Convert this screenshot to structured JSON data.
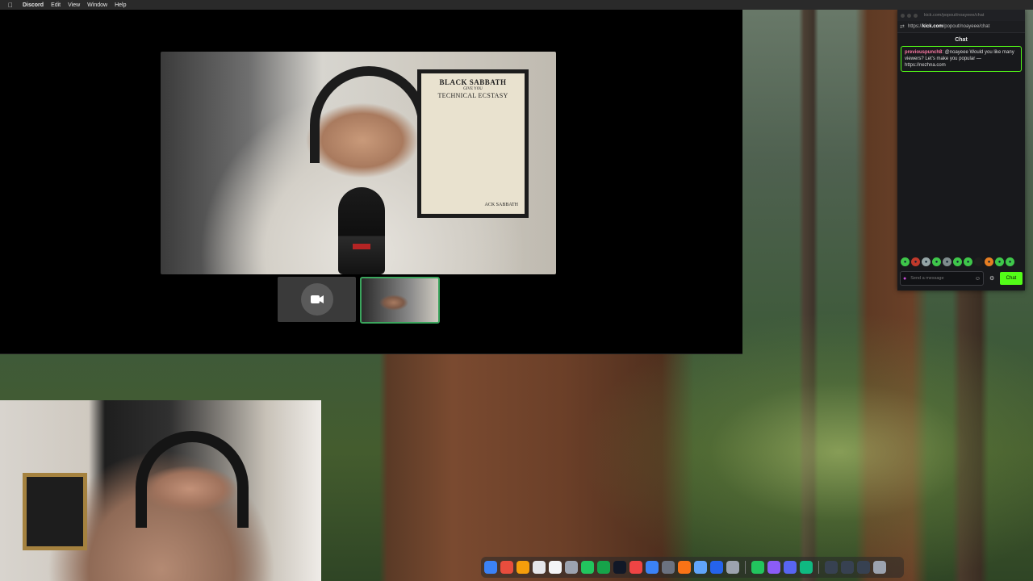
{
  "menubar": {
    "app_name": "Discord",
    "items": [
      "Edit",
      "View",
      "Window",
      "Help"
    ]
  },
  "discord": {
    "main_video_poster": {
      "line1": "BLACK SABBATH",
      "line2": "GIVE YOU",
      "line3": "TECHNICAL ECSTASY",
      "line4": "ACK SABBATH"
    }
  },
  "kick_chat": {
    "url_plain_1": "https://",
    "url_bold": "kick.com",
    "url_plain_2": "/popout/noayeee/chat",
    "titlebar_url": "kick.com/popout/noayeee/chat",
    "heading": "Chat",
    "message": {
      "username": "previouspunch8",
      "text": ": @noayeee Would you like many viewers? Let's make you popular — https://nezhna.com"
    },
    "input_placeholder": "Send a message",
    "send_label": "Chat",
    "colors": {
      "accent": "#53fc18",
      "username": "#ff7aa6"
    }
  },
  "dock": {
    "apps": [
      {
        "name": "finder-icon",
        "color": "#3b82f6"
      },
      {
        "name": "chrome-icon",
        "color": "#e84d3d"
      },
      {
        "name": "photos-icon",
        "color": "#f59e0b"
      },
      {
        "name": "notes-icon",
        "color": "#e5e7eb"
      },
      {
        "name": "calendar-icon",
        "color": "#f3f4f6"
      },
      {
        "name": "launchpad-icon",
        "color": "#9ca3af"
      },
      {
        "name": "maps-icon",
        "color": "#22c55e"
      },
      {
        "name": "facetime-icon",
        "color": "#16a34a"
      },
      {
        "name": "terminal-icon",
        "color": "#111827"
      },
      {
        "name": "music-icon",
        "color": "#ef4444"
      },
      {
        "name": "app-store-icon",
        "color": "#3b82f6"
      },
      {
        "name": "settings-icon",
        "color": "#6b7280"
      },
      {
        "name": "chrome-browser-icon",
        "color": "#f97316"
      },
      {
        "name": "safari-icon",
        "color": "#60a5fa"
      },
      {
        "name": "word-icon",
        "color": "#2563eb"
      },
      {
        "name": "utility-icon",
        "color": "#9ca3af"
      },
      {
        "name": "spotify-icon",
        "color": "#22c55e"
      },
      {
        "name": "star-icon",
        "color": "#8b5cf6"
      },
      {
        "name": "discord-icon",
        "color": "#5865f2"
      },
      {
        "name": "messages-icon",
        "color": "#10b981"
      },
      {
        "name": "window-thumb-1-icon",
        "color": "#374151"
      },
      {
        "name": "window-thumb-2-icon",
        "color": "#374151"
      },
      {
        "name": "window-thumb-3-icon",
        "color": "#374151"
      },
      {
        "name": "trash-icon",
        "color": "#9ca3af"
      }
    ]
  }
}
